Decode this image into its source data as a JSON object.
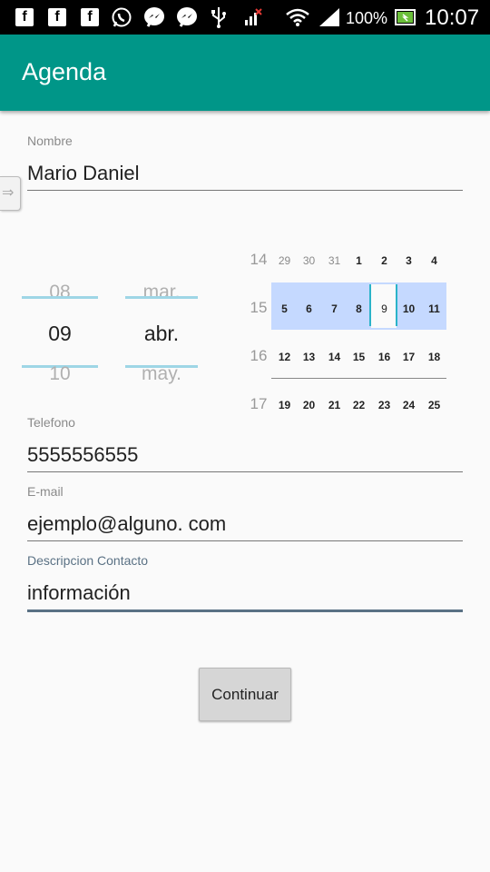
{
  "status_bar": {
    "notification_icons": [
      "facebook-icon",
      "facebook-icon",
      "facebook-icon",
      "whatsapp-icon",
      "messenger-icon",
      "messenger-icon",
      "usb-icon",
      "signal-off-icon"
    ],
    "battery": "100%",
    "time": "10:07"
  },
  "appbar": {
    "title": "Agenda"
  },
  "form": {
    "nombre": {
      "label": "Nombre",
      "value": "Mario Daniel"
    },
    "telefono": {
      "label": "Telefono",
      "value": "5555556555"
    },
    "email": {
      "label": "E-mail",
      "value": "ejemplo@alguno. com"
    },
    "descripcion": {
      "label": "Descripcion Contacto",
      "value": "información"
    }
  },
  "date_picker": {
    "day": {
      "prev": "08",
      "current": "09",
      "next": "10"
    },
    "month": {
      "prev": "mar.",
      "current": "abr.",
      "next": "may."
    }
  },
  "calendar": {
    "weeks": [
      {
        "week": "14",
        "days": [
          "29",
          "30",
          "31",
          "1",
          "2",
          "3",
          "4"
        ]
      },
      {
        "week": "15",
        "days": [
          "5",
          "6",
          "7",
          "8",
          "9",
          "10",
          "11"
        ]
      },
      {
        "week": "16",
        "days": [
          "12",
          "13",
          "14",
          "15",
          "16",
          "17",
          "18"
        ]
      },
      {
        "week": "17",
        "days": [
          "19",
          "20",
          "21",
          "22",
          "23",
          "24",
          "25"
        ]
      }
    ]
  },
  "actions": {
    "continue_label": "Continuar"
  },
  "colors": {
    "appbar": "#009688",
    "selected_week": "#c5d9ff",
    "accent_line": "#2ab3c9"
  }
}
